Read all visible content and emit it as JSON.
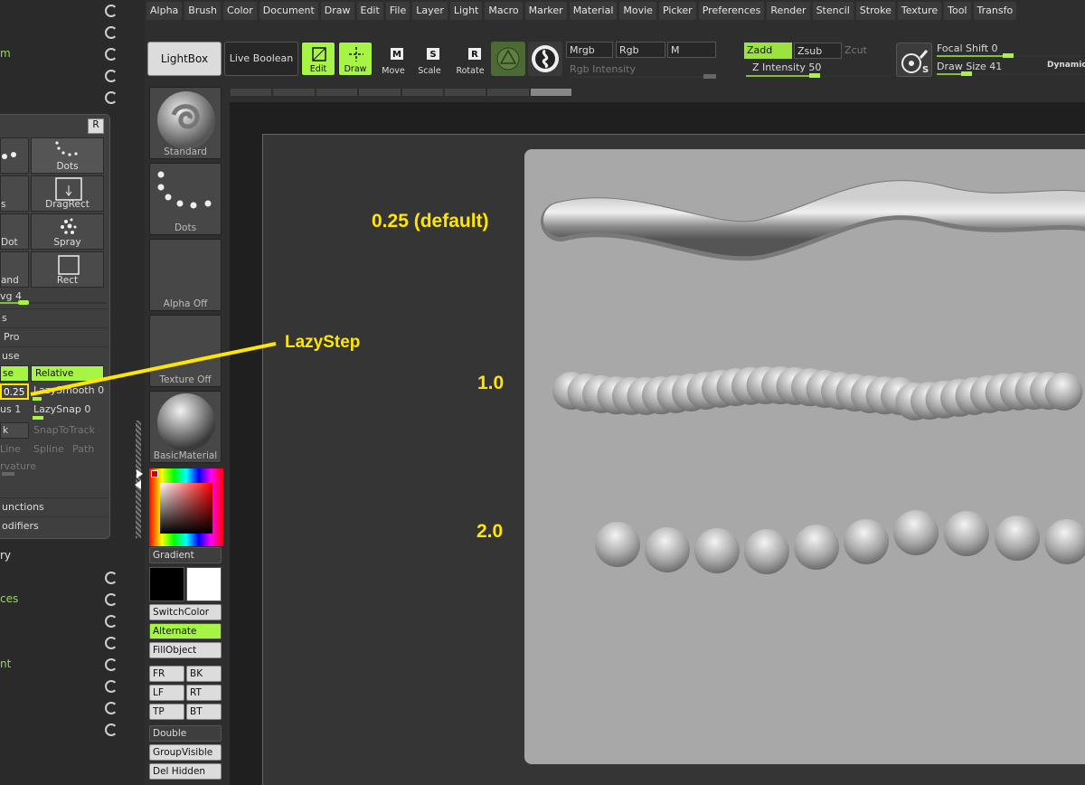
{
  "menu": [
    "Alpha",
    "Brush",
    "Color",
    "Document",
    "Draw",
    "Edit",
    "File",
    "Layer",
    "Light",
    "Macro",
    "Marker",
    "Material",
    "Movie",
    "Picker",
    "Preferences",
    "Render",
    "Stencil",
    "Stroke",
    "Texture",
    "Tool",
    "Transfo"
  ],
  "left": {
    "top_green": "m",
    "bottom_items": [
      "ry",
      "ces",
      "nt"
    ]
  },
  "stroke_panel": {
    "r_label": "R",
    "tiles": [
      "",
      "Dots",
      "s",
      "DragRect",
      "Dot",
      "Spray",
      "and",
      "Rect"
    ],
    "avg": "vg 4",
    "rows": [
      "s",
      "Pro",
      "use"
    ],
    "use_label": "se",
    "relative": "Relative",
    "lazystep_val": "0.25",
    "lazysmooth": "LazySmooth 0",
    "us_label": "us 1",
    "lazysnap": "LazySnap 0",
    "k_label": "k",
    "snaptotrack": "SnapToTrack",
    "line": "Line",
    "spline": "Spline",
    "path": "Path",
    "curvature": "rvature",
    "functions": "unctions",
    "modifiers": "odifiers"
  },
  "toolbar": {
    "lightbox": "LightBox",
    "liveboolean": "Live Boolean",
    "edit": "Edit",
    "draw": "Draw",
    "move": "Move",
    "scale": "Scale",
    "rotate": "Rotate",
    "mrgb": "Mrgb",
    "rgb": "Rgb",
    "m": "M",
    "rgb_intensity": "Rgb Intensity",
    "zadd": "Zadd",
    "zsub": "Zsub",
    "zcut": "Zcut",
    "z_intensity": "Z Intensity 50",
    "focal_shift": "Focal Shift 0",
    "draw_size": "Draw Size 41",
    "dynamic": "Dynamic"
  },
  "shelf": {
    "standard": "Standard",
    "dots": "Dots",
    "alpha_off": "Alpha Off",
    "texture_off": "Texture Off",
    "basic_material": "BasicMaterial",
    "gradient": "Gradient",
    "switch_color": "SwitchColor",
    "alternate": "Alternate",
    "fill_object": "FillObject",
    "fr": "FR",
    "bk": "BK",
    "lf": "LF",
    "rt": "RT",
    "tp": "TP",
    "bt": "BT",
    "double": "Double",
    "group_visible": "GroupVisible",
    "del_hidden": "Del Hidden"
  },
  "canvas": {
    "label_025": "0.25 (default)",
    "label_10": "1.0",
    "label_20": "2.0",
    "callout": "LazyStep"
  },
  "colors": {
    "accent": "#a6f545",
    "label": "#ffe600"
  }
}
